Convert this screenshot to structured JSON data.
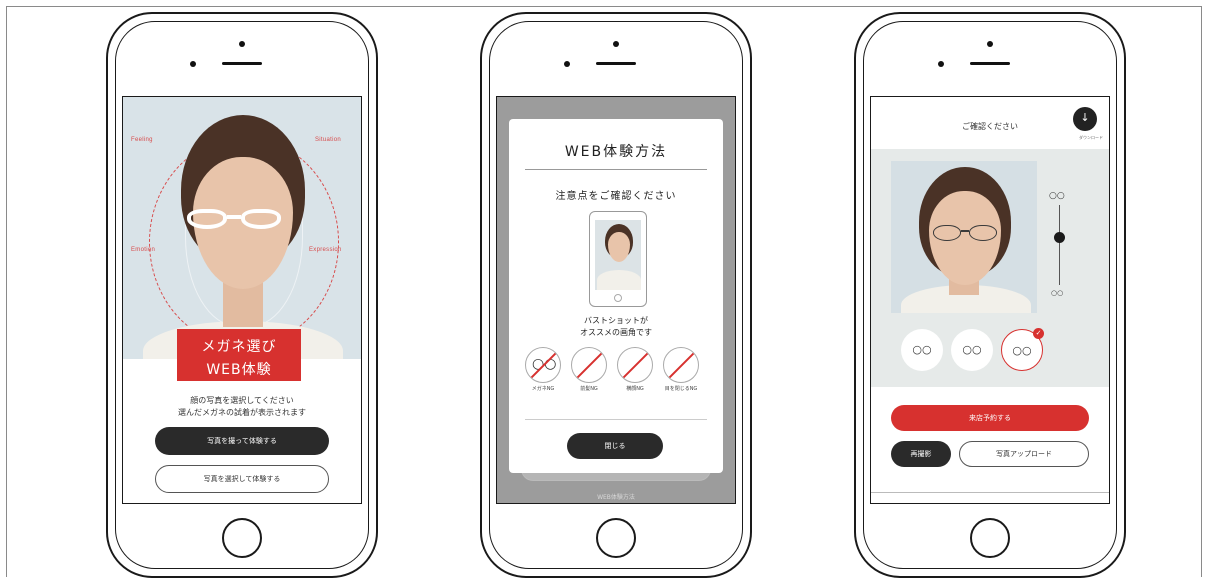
{
  "colors": {
    "accent": "#d7312f",
    "dark_button": "#2a2a2a",
    "frame": "#1a1a1a"
  },
  "screen1": {
    "hud": {
      "feeling": "Feeling",
      "situation": "Situation",
      "emotion": "Emotion",
      "expression": "Expression"
    },
    "banner_line1": "メガネ選び",
    "banner_line2": "WEB体験",
    "note_line1": "顔の写真を選択してください",
    "note_line2": "選んだメガネの試着が表示されます",
    "take_photo_button": "写真を撮って体験する",
    "choose_photo_button": "写真を選択して体験する"
  },
  "screen2": {
    "modal_title": "WEB体験方法",
    "modal_subtitle": "注意点をご確認ください",
    "caption_line1": "バストショットが",
    "caption_line2": "オススメの画角です",
    "ng_items": [
      {
        "label": "メガネNG",
        "icon": "glasses-icon"
      },
      {
        "label": "前髪NG",
        "icon": "bangs-icon"
      },
      {
        "label": "横顔NG",
        "icon": "profile-icon"
      },
      {
        "label": "目を閉じるNG",
        "icon": "closed-eyes-icon"
      }
    ],
    "close_button": "閉じる",
    "background_label": "WEB体験方法"
  },
  "screen3": {
    "title": "ご確認ください",
    "download_label": "ダウンロード",
    "reserve_button": "来店予約する",
    "retake_button": "再撮影",
    "upload_button": "写真アップロード",
    "frame_thumbs": [
      {
        "name": "frame-1",
        "selected": false
      },
      {
        "name": "frame-2",
        "selected": false
      },
      {
        "name": "frame-3",
        "selected": true
      }
    ],
    "size_slider_level": 0.4
  }
}
